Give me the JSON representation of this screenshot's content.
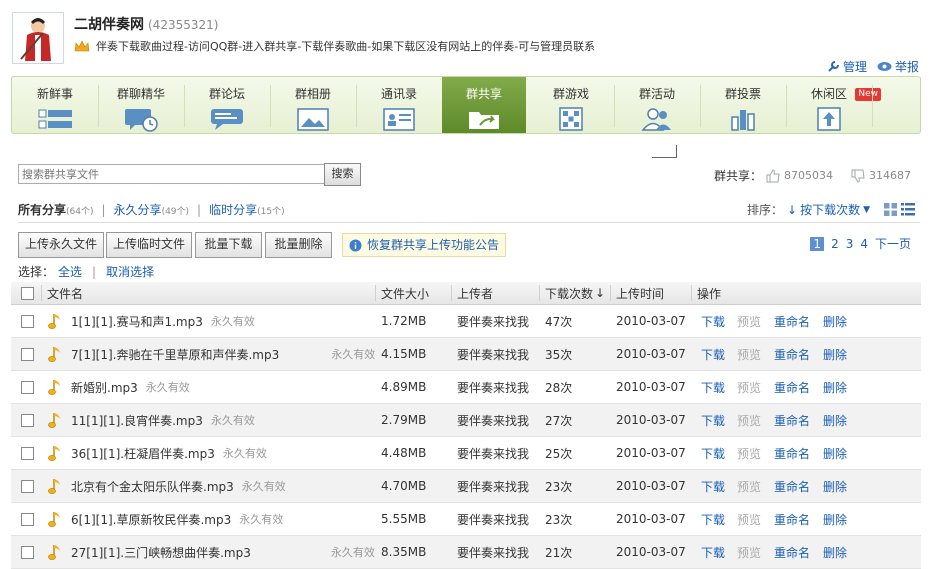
{
  "header": {
    "title": "二胡伴奏网",
    "id": "(42355321)",
    "announcement": "伴奏下载歌曲过程-访问QQ群-进入群共享-下载伴奏歌曲-如果下载区没有网站上的伴奏-可与管理员联系",
    "manage_label": "管理",
    "report_label": "举报"
  },
  "nav": {
    "tabs": [
      {
        "label": "新鲜事",
        "icon": "list-icon"
      },
      {
        "label": "群聊精华",
        "icon": "chat-clock-icon"
      },
      {
        "label": "群论坛",
        "icon": "forum-bubble-icon"
      },
      {
        "label": "群相册",
        "icon": "photo-icon"
      },
      {
        "label": "通讯录",
        "icon": "contact-card-icon"
      },
      {
        "label": "群共享",
        "icon": "folder-share-icon"
      },
      {
        "label": "群游戏",
        "icon": "game-board-icon"
      },
      {
        "label": "群活动",
        "icon": "people-icon"
      },
      {
        "label": "群投票",
        "icon": "bar-chart-icon"
      },
      {
        "label": "休闲区",
        "icon": "leisure-icon"
      }
    ],
    "active_index": 5,
    "new_badge": "New"
  },
  "search": {
    "placeholder": "搜索群共享文件",
    "button": "搜索"
  },
  "stats": {
    "label": "群共享：",
    "likes": "8705034",
    "dislikes": "314687"
  },
  "filters": {
    "all": "所有分享",
    "all_count": "(64个)",
    "permanent": "永久分享",
    "permanent_count": "(49个)",
    "temporary": "临时分享",
    "temporary_count": "(15个)"
  },
  "sort": {
    "label": "排序：",
    "value": "按下载次数"
  },
  "actions": {
    "upload_permanent": "上传永久文件",
    "upload_temporary": "上传临时文件",
    "batch_download": "批量下载",
    "batch_delete": "批量删除",
    "notice": "恢复群共享上传功能公告"
  },
  "pager": {
    "pages": [
      "1",
      "2",
      "3",
      "4"
    ],
    "current": "1",
    "next": "下一页"
  },
  "selection": {
    "label": "选择：",
    "all": "全选",
    "cancel": "取消选择"
  },
  "table": {
    "headers": {
      "name": "文件名",
      "size": "文件大小",
      "uploader": "上传者",
      "downloads": "下载次数",
      "time": "上传时间",
      "ops": "操作"
    },
    "op_labels": {
      "download": "下载",
      "preview": "预览",
      "rename": "重命名",
      "delete": "删除"
    },
    "rows": [
      {
        "name": "1[1][1].赛马和声1.mp3",
        "validity": "永久有效",
        "size": "1.72MB",
        "uploader": "要伴奏来找我",
        "downloads": "47次",
        "time": "2010-03-07"
      },
      {
        "name": "7[1][1].奔驰在千里草原和声伴奏.mp3",
        "validity": "永久有效",
        "size": "4.15MB",
        "uploader": "要伴奏来找我",
        "downloads": "35次",
        "time": "2010-03-07"
      },
      {
        "name": "新婚别.mp3",
        "validity": "永久有效",
        "size": "4.89MB",
        "uploader": "要伴奏来找我",
        "downloads": "28次",
        "time": "2010-03-07"
      },
      {
        "name": "11[1][1].良宵伴奏.mp3",
        "validity": "永久有效",
        "size": "2.79MB",
        "uploader": "要伴奏来找我",
        "downloads": "27次",
        "time": "2010-03-07"
      },
      {
        "name": "36[1][1].枉凝眉伴奏.mp3",
        "validity": "永久有效",
        "size": "4.48MB",
        "uploader": "要伴奏来找我",
        "downloads": "25次",
        "time": "2010-03-07"
      },
      {
        "name": "北京有个金太阳乐队伴奏.mp3",
        "validity": "永久有效",
        "size": "4.70MB",
        "uploader": "要伴奏来找我",
        "downloads": "23次",
        "time": "2010-03-07"
      },
      {
        "name": "6[1][1].草原新牧民伴奏.mp3",
        "validity": "永久有效",
        "size": "5.55MB",
        "uploader": "要伴奏来找我",
        "downloads": "23次",
        "time": "2010-03-07"
      },
      {
        "name": "27[1][1].三门峡畅想曲伴奏.mp3",
        "validity": "永久有效",
        "size": "8.35MB",
        "uploader": "要伴奏来找我",
        "downloads": "21次",
        "time": "2010-03-07"
      }
    ]
  },
  "colors": {
    "link": "#1a5fb4",
    "nav_active": "#6b9636",
    "nav_border": "#c8d8a8"
  }
}
